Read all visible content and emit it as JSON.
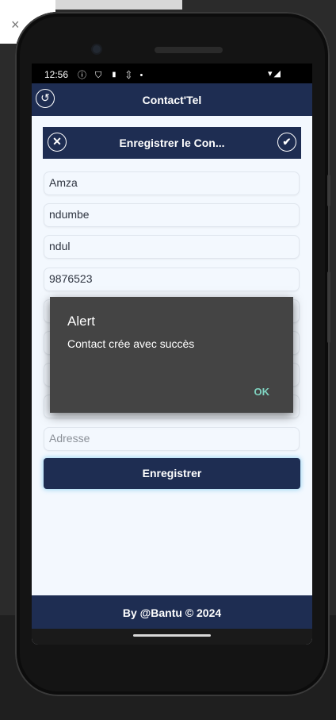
{
  "status_bar": {
    "time": "12:56",
    "icons": "ⓘ ⛉ ▮ ⇕ •",
    "signal": "▾◢"
  },
  "app_bar": {
    "title": "Contact'Tel",
    "back_icon": "undo-arrow-icon"
  },
  "form_header": {
    "title": "Enregistrer le Con...",
    "close_icon": "close-icon",
    "confirm_icon": "check-icon"
  },
  "fields": [
    {
      "value": "Amza",
      "placeholder": ""
    },
    {
      "value": "ndumbe",
      "placeholder": ""
    },
    {
      "value": "ndul",
      "placeholder": ""
    },
    {
      "value": "9876523",
      "placeholder": ""
    },
    {
      "value": "",
      "placeholder": "Adresse"
    }
  ],
  "save_button": {
    "label": "Enregistrer"
  },
  "footer": {
    "text": "By @Bantu © 2024"
  },
  "alert": {
    "title": "Alert",
    "message": "Contact crée avec succès",
    "ok_label": "OK"
  },
  "colors": {
    "primary": "#1e2d52",
    "screen_bg": "#f3f8fe",
    "dialog_bg": "#444444",
    "dialog_accent": "#7fd3c0"
  }
}
